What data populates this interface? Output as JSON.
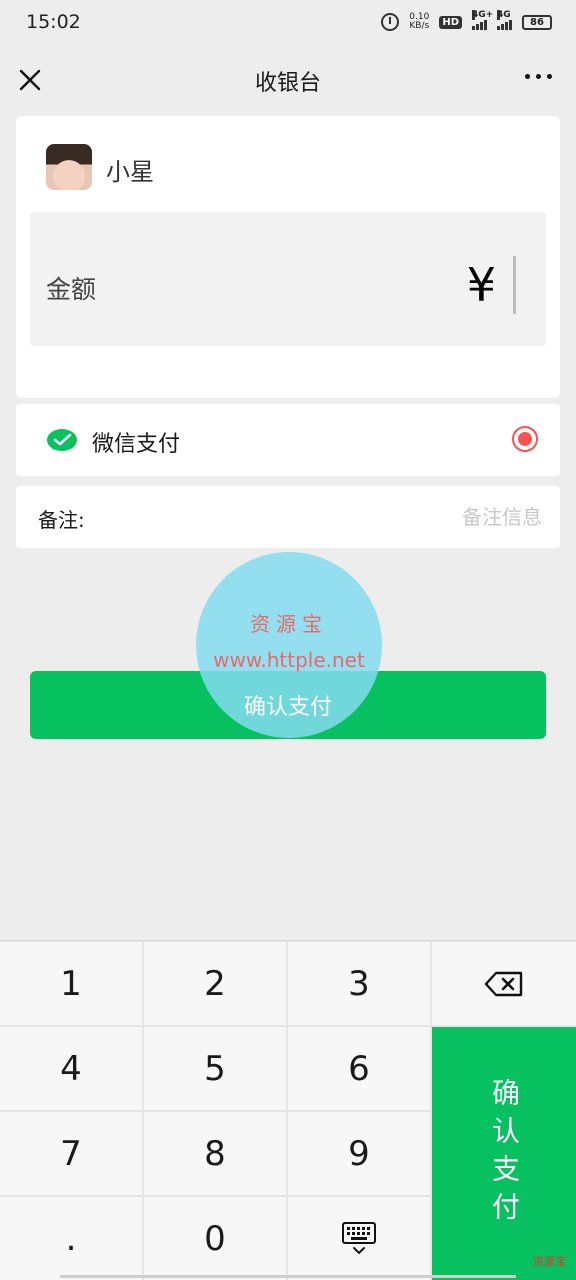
{
  "status_bar": {
    "time": "15:02",
    "net_speed_value": "0.10",
    "net_speed_unit": "KB/s",
    "hd_label": "HD",
    "signal1_label": "4G+",
    "signal2_label": "4G",
    "battery": "86"
  },
  "nav": {
    "title": "收银台"
  },
  "payee": {
    "name": "小星",
    "amount_label": "金额",
    "currency_symbol": "¥"
  },
  "payment_method": {
    "label": "微信支付",
    "selected": true
  },
  "remark": {
    "label": "备注:",
    "placeholder": "备注信息"
  },
  "watermark": {
    "line1": "资源宝",
    "line2": "www.httple.net"
  },
  "confirm_button": {
    "label": "确认支付"
  },
  "keypad": {
    "keys": [
      "1",
      "2",
      "3",
      "4",
      "5",
      "6",
      "7",
      "8",
      "9",
      ".",
      "0"
    ],
    "pay_label": "确认支付",
    "corner_mark": "资源宝"
  },
  "colors": {
    "wechat_green": "#07c160",
    "radio_red": "#fa5151"
  },
  "icons": [
    "alarm-icon",
    "close-icon",
    "more-icon",
    "wechat-pay-icon",
    "backspace-icon",
    "keyboard-hide-icon"
  ]
}
